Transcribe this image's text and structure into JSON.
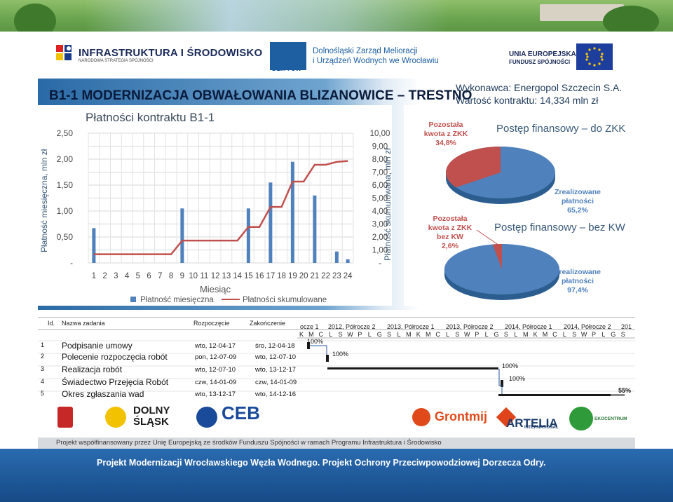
{
  "header": {
    "logo_ip_line1": "INFRASTRUKTURA I ŚRODOWISKO",
    "logo_ip_line2": "NARODOWA STRATEGIA SPÓJNOŚCI",
    "logo_dzm_line1": "Dolnośląski Zarząd Melioracji",
    "logo_dzm_line2": "i Urządzeń Wodnych we Wrocławiu",
    "logo_dzm_mark": "DZM i UW",
    "logo_ue_line1": "UNIA EUROPEJSKA",
    "logo_ue_line2": "FUNDUSZ SPÓJNOŚCI"
  },
  "title": "B1-1 MODERNIZACJA OBWAŁOWANIA BLIZANOWICE – TRESTNO",
  "contractor": "Wykonawca: Energopol Szczecin S.A.",
  "contract_value": "Wartość kontraktu: 14,334 mln zł",
  "payments_chart": {
    "title": "Płatności kontraktu B1-1",
    "ylabel_left": "Płatność miesięczna, mln zł",
    "ylabel_right": "Płatność skumulowana, mln zł",
    "xlabel": "Miesiąc",
    "legend_monthly": "Płatność miesięczna",
    "legend_cumulative": "Płatności skumulowane",
    "left_ticks": [
      "2,50",
      "2,00",
      "1,50",
      "1,00",
      "0,50",
      "-"
    ],
    "right_ticks": [
      "10,00",
      "9,00",
      "8,00",
      "7,00",
      "6,00",
      "5,00",
      "4,00",
      "3,00",
      "2,00",
      "1,00",
      "-"
    ],
    "colors": {
      "monthly": "#4f81bd",
      "cumulative": "#c0504d"
    }
  },
  "chart_data": {
    "type": "bar",
    "categories": [
      "1",
      "2",
      "3",
      "4",
      "5",
      "6",
      "7",
      "8",
      "9",
      "10",
      "11",
      "12",
      "13",
      "14",
      "15",
      "16",
      "17",
      "18",
      "19",
      "20",
      "21",
      "22",
      "23",
      "24"
    ],
    "xlabel": "Miesiąc",
    "ylabel": "Płatność miesięczna, mln zł",
    "ylim": [
      0,
      2.5
    ],
    "y2lim": [
      0,
      10
    ],
    "series": [
      {
        "name": "Płatność miesięczna",
        "type": "bar",
        "axis": "left",
        "values": [
          0.67,
          0,
          0,
          0,
          0,
          0,
          0,
          0,
          1.05,
          0,
          0,
          0,
          0,
          0,
          1.05,
          0,
          1.55,
          0,
          1.95,
          0,
          1.3,
          0,
          0.22,
          0.07
        ]
      },
      {
        "name": "Płatności skumulowane",
        "type": "line",
        "axis": "right",
        "values": [
          0.67,
          0.67,
          0.67,
          0.67,
          0.67,
          0.67,
          0.67,
          0.67,
          1.72,
          1.72,
          1.72,
          1.72,
          1.72,
          1.72,
          2.77,
          2.77,
          4.32,
          4.32,
          6.27,
          6.27,
          7.57,
          7.57,
          7.79,
          7.86
        ]
      }
    ]
  },
  "pie_zkk": {
    "title": "Postęp finansowy – do ZKK",
    "remaining_label": "Pozostała kwota z ZKK",
    "remaining_value": "34,8%",
    "done_label": "Zrealizowane płatności",
    "done_value": "65,2%",
    "values": [
      34.8,
      65.2
    ],
    "colors": {
      "remaining": "#c0504d",
      "done": "#4f81bd"
    }
  },
  "pie_kw": {
    "title": "Postęp finansowy – bez KW",
    "remaining_label": "Pozostała kwota z ZKK bez KW",
    "remaining_value": "2,6%",
    "done_label": "Zrealizowane płatności",
    "done_value": "97,4%",
    "values": [
      2.6,
      97.4
    ]
  },
  "gantt": {
    "col_id": "Id.",
    "col_name": "Nazwa zadania",
    "col_start": "Rozpoczęcie",
    "col_end": "Zakończenie",
    "periods": [
      "ocze 1",
      "2012, Półrocze 2",
      "2013, Półrocze 1",
      "2013, Półrocze 2",
      "2014, Półrocze 1",
      "2014, Półrocze 2",
      "201"
    ],
    "months": [
      "K",
      "M",
      "C",
      "L",
      "S",
      "W",
      "P",
      "L",
      "G",
      "S",
      "L",
      "M",
      "K",
      "M",
      "C",
      "L",
      "S",
      "W",
      "P",
      "L",
      "G",
      "S",
      "L",
      "M",
      "K",
      "M",
      "C",
      "L",
      "S",
      "W",
      "P",
      "L",
      "G",
      "S"
    ],
    "tasks": [
      {
        "id": "1",
        "name": "Podpisanie umowy",
        "start": "wto, 12-04-17",
        "end": "śro, 12-04-18",
        "pct": "100%"
      },
      {
        "id": "2",
        "name": "Polecenie rozpoczęcia robót",
        "start": "pon, 12-07-09",
        "end": "wto, 12-07-10",
        "pct": "100%"
      },
      {
        "id": "3",
        "name": "Realizacja robót",
        "start": "wto, 12-07-10",
        "end": "wto, 13-12-17",
        "pct": "100%"
      },
      {
        "id": "4",
        "name": "Świadectwo Przejęcia Robót",
        "start": "czw, 14-01-09",
        "end": "czw, 14-01-09",
        "pct": "100%"
      },
      {
        "id": "5",
        "name": "Okres zgłaszania wad",
        "start": "wto, 13-12-17",
        "end": "wto, 14-12-16",
        "pct": "55%"
      }
    ]
  },
  "bottom_logos": {
    "dolny_1": "DOLNY",
    "dolny_2": "ŚLĄSK",
    "ceb": "CEB",
    "grontmij": "Grontmij",
    "artelia": "ARTELIA",
    "artelia_sub": "INTERNATIONAL",
    "ekocentrum": "EKOCENTRUM"
  },
  "funded_text": "Projekt współfinansowany przez Unię Europejską ze środków Funduszu Spójności w ramach Programu Infrastruktura i Środowisko",
  "footer_text": "Projekt Modernizacji Wrocławskiego Węzła Wodnego. Projekt Ochrony Przeciwpowodziowej Dorzecza Odry."
}
